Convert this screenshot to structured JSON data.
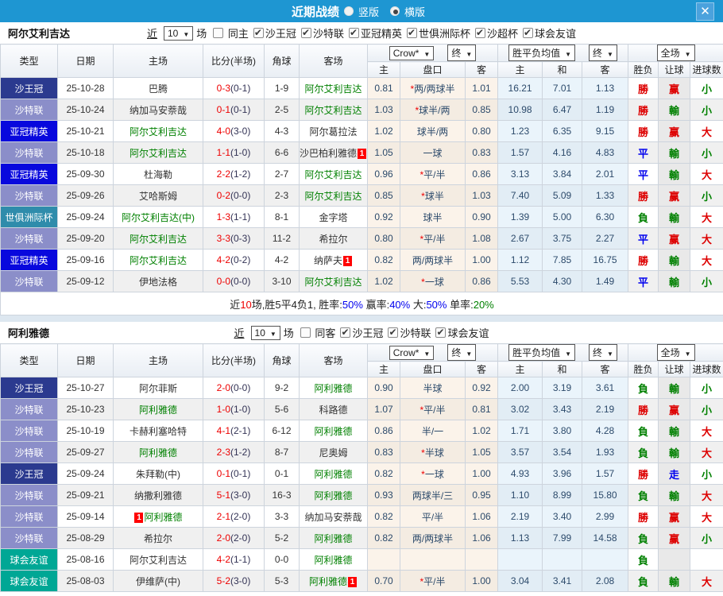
{
  "titlebar": {
    "title": "近期战绩",
    "radio_options": [
      {
        "label": "竖版",
        "selected": false
      },
      {
        "label": "横版",
        "selected": true
      }
    ],
    "close_icon": "✕"
  },
  "columns": {
    "type": "类型",
    "date": "日期",
    "home": "主场",
    "score": "比分(半场)",
    "corner": "角球",
    "away": "客场",
    "odds_home": "主",
    "handicap": "盘口",
    "odds_away": "客",
    "avg_win": "主",
    "avg_draw": "和",
    "avg_lose": "客",
    "result": "胜负",
    "handicap_result": "让球",
    "goals": "进球数"
  },
  "dropdowns": {
    "crow": "Crow*",
    "final_a": "终",
    "wdl_avg": "胜平负均值",
    "final_b": "终",
    "full": "全场"
  },
  "type_colors": {
    "沙王冠": "#2b3a8f",
    "沙特联": "#8b8ec9",
    "亚冠精英": "#0808dd",
    "世俱洲际杯": "#2f8cab",
    "球会友谊": "#00a795"
  },
  "result_colors": {
    "勝": "#dd0000",
    "赢": "#dd0000",
    "大": "#dd0000",
    "平": "#0000ee",
    "走": "#0000ee",
    "負": "#008000",
    "輸": "#008000",
    "小": "#008000"
  },
  "sections": [
    {
      "team": "阿尔艾利吉达",
      "filter": {
        "near": "近",
        "count": "10",
        "unit": "场",
        "same": {
          "label": "同主",
          "checked": false
        },
        "leagues": [
          {
            "label": "沙王冠",
            "checked": true
          },
          {
            "label": "沙特联",
            "checked": true
          },
          {
            "label": "亚冠精英",
            "checked": true
          },
          {
            "label": "世俱洲际杯",
            "checked": true
          },
          {
            "label": "沙超杯",
            "checked": true
          },
          {
            "label": "球会友谊",
            "checked": true
          }
        ]
      },
      "rows": [
        {
          "type": "沙王冠",
          "date": "25-10-28",
          "home": {
            "name": "巴腾"
          },
          "score_ft": "0-3",
          "score_ht": "(0-1)",
          "corner": "1-9",
          "away": {
            "name": "阿尔艾利吉达",
            "green": true
          },
          "crow_home": "0.81",
          "crow_hc": "*两/两球半",
          "crow_away": "1.01",
          "avg_win": "16.21",
          "avg_draw": "7.01",
          "avg_lose": "1.13",
          "res": "勝",
          "hc_res": "赢",
          "goal_res": "小"
        },
        {
          "type": "沙特联",
          "date": "25-10-24",
          "home": {
            "name": "纳加马安萘哉"
          },
          "score_ft": "0-1",
          "score_ht": "(0-1)",
          "corner": "2-5",
          "away": {
            "name": "阿尔艾利吉达",
            "green": true
          },
          "crow_home": "1.03",
          "crow_hc": "*球半/两",
          "crow_away": "0.85",
          "avg_win": "10.98",
          "avg_draw": "6.47",
          "avg_lose": "1.19",
          "res": "勝",
          "hc_res": "輸",
          "goal_res": "小"
        },
        {
          "type": "亚冠精英",
          "date": "25-10-21",
          "home": {
            "name": "阿尔艾利吉达",
            "green": true
          },
          "score_ft": "4-0",
          "score_ht": "(3-0)",
          "corner": "4-3",
          "away": {
            "name": "阿尔葛拉法"
          },
          "crow_home": "1.02",
          "crow_hc": "球半/两",
          "crow_away": "0.80",
          "avg_win": "1.23",
          "avg_draw": "6.35",
          "avg_lose": "9.15",
          "res": "勝",
          "hc_res": "赢",
          "goal_res": "大"
        },
        {
          "type": "沙特联",
          "date": "25-10-18",
          "home": {
            "name": "阿尔艾利吉达",
            "green": true
          },
          "score_ft": "1-1",
          "score_ht": "(1-0)",
          "corner": "6-6",
          "away": {
            "name": "沙巴柏利雅德",
            "rc": "post"
          },
          "crow_home": "1.05",
          "crow_hc": "一球",
          "crow_away": "0.83",
          "avg_win": "1.57",
          "avg_draw": "4.16",
          "avg_lose": "4.83",
          "res": "平",
          "hc_res": "輸",
          "goal_res": "小"
        },
        {
          "type": "亚冠精英",
          "date": "25-09-30",
          "home": {
            "name": "杜海勒"
          },
          "score_ft": "2-2",
          "score_ht": "(1-2)",
          "corner": "2-7",
          "away": {
            "name": "阿尔艾利吉达",
            "green": true
          },
          "crow_home": "0.96",
          "crow_hc": "*平/半",
          "crow_away": "0.86",
          "avg_win": "3.13",
          "avg_draw": "3.84",
          "avg_lose": "2.01",
          "res": "平",
          "hc_res": "輸",
          "goal_res": "大"
        },
        {
          "type": "沙特联",
          "date": "25-09-26",
          "home": {
            "name": "艾哈斯姆"
          },
          "score_ft": "0-2",
          "score_ht": "(0-0)",
          "corner": "2-3",
          "away": {
            "name": "阿尔艾利吉达",
            "green": true
          },
          "crow_home": "0.85",
          "crow_hc": "*球半",
          "crow_away": "1.03",
          "avg_win": "7.40",
          "avg_draw": "5.09",
          "avg_lose": "1.33",
          "res": "勝",
          "hc_res": "赢",
          "goal_res": "小"
        },
        {
          "type": "世俱洲际杯",
          "date": "25-09-24",
          "home": {
            "name": "阿尔艾利吉达(中)",
            "green": true
          },
          "score_ft": "1-3",
          "score_ht": "(1-1)",
          "corner": "8-1",
          "away": {
            "name": "金字塔"
          },
          "crow_home": "0.92",
          "crow_hc": "球半",
          "crow_away": "0.90",
          "avg_win": "1.39",
          "avg_draw": "5.00",
          "avg_lose": "6.30",
          "res": "負",
          "hc_res": "輸",
          "goal_res": "大"
        },
        {
          "type": "沙特联",
          "date": "25-09-20",
          "home": {
            "name": "阿尔艾利吉达",
            "green": true
          },
          "score_ft": "3-3",
          "score_ht": "(0-3)",
          "corner": "11-2",
          "away": {
            "name": "希拉尔"
          },
          "crow_home": "0.80",
          "crow_hc": "*平/半",
          "crow_away": "1.08",
          "avg_win": "2.67",
          "avg_draw": "3.75",
          "avg_lose": "2.27",
          "res": "平",
          "hc_res": "赢",
          "goal_res": "大"
        },
        {
          "type": "亚冠精英",
          "date": "25-09-16",
          "home": {
            "name": "阿尔艾利吉达",
            "green": true
          },
          "score_ft": "4-2",
          "score_ht": "(0-2)",
          "corner": "4-2",
          "away": {
            "name": "纳萨夫",
            "rc": "post"
          },
          "crow_home": "0.82",
          "crow_hc": "两/两球半",
          "crow_away": "1.00",
          "avg_win": "1.12",
          "avg_draw": "7.85",
          "avg_lose": "16.75",
          "res": "勝",
          "hc_res": "輸",
          "goal_res": "大"
        },
        {
          "type": "沙特联",
          "date": "25-09-12",
          "home": {
            "name": "伊地法格"
          },
          "score_ft": "0-0",
          "score_ht": "(0-0)",
          "corner": "3-10",
          "away": {
            "name": "阿尔艾利吉达",
            "green": true
          },
          "crow_home": "1.02",
          "crow_hc": "*一球",
          "crow_away": "0.86",
          "avg_win": "5.53",
          "avg_draw": "4.30",
          "avg_lose": "1.49",
          "res": "平",
          "hc_res": "輸",
          "goal_res": "小"
        }
      ],
      "summary": [
        {
          "t": "近",
          "c": "#222222"
        },
        {
          "t": "10",
          "c": "#ee0000"
        },
        {
          "t": "场,胜5平4负1, 胜率:",
          "c": "#222222"
        },
        {
          "t": "50%",
          "c": "#0000ee"
        },
        {
          "t": " 赢率:",
          "c": "#222222"
        },
        {
          "t": "40%",
          "c": "#0000ee"
        },
        {
          "t": " 大:",
          "c": "#222222"
        },
        {
          "t": "50%",
          "c": "#0000ee"
        },
        {
          "t": " 单率:",
          "c": "#222222"
        },
        {
          "t": "20%",
          "c": "#008000"
        }
      ]
    },
    {
      "team": "阿利雅德",
      "filter": {
        "near": "近",
        "count": "10",
        "unit": "场",
        "same": {
          "label": "同客",
          "checked": false
        },
        "leagues": [
          {
            "label": "沙王冠",
            "checked": true
          },
          {
            "label": "沙特联",
            "checked": true
          },
          {
            "label": "球会友谊",
            "checked": true
          }
        ]
      },
      "rows": [
        {
          "type": "沙王冠",
          "date": "25-10-27",
          "home": {
            "name": "阿尔菲斯"
          },
          "score_ft": "2-0",
          "score_ht": "(0-0)",
          "corner": "9-2",
          "away": {
            "name": "阿利雅德",
            "green": true
          },
          "crow_home": "0.90",
          "crow_hc": "半球",
          "crow_away": "0.92",
          "avg_win": "2.00",
          "avg_draw": "3.19",
          "avg_lose": "3.61",
          "res": "負",
          "hc_res": "輸",
          "goal_res": "小"
        },
        {
          "type": "沙特联",
          "date": "25-10-23",
          "home": {
            "name": "阿利雅德",
            "green": true
          },
          "score_ft": "1-0",
          "score_ht": "(1-0)",
          "corner": "5-6",
          "away": {
            "name": "科路德"
          },
          "crow_home": "1.07",
          "crow_hc": "*平/半",
          "crow_away": "0.81",
          "avg_win": "3.02",
          "avg_draw": "3.43",
          "avg_lose": "2.19",
          "res": "勝",
          "hc_res": "赢",
          "goal_res": "小"
        },
        {
          "type": "沙特联",
          "date": "25-10-19",
          "home": {
            "name": "卡赫利塞哈特"
          },
          "score_ft": "4-1",
          "score_ht": "(2-1)",
          "corner": "6-12",
          "away": {
            "name": "阿利雅德",
            "green": true
          },
          "crow_home": "0.86",
          "crow_hc": "半/一",
          "crow_away": "1.02",
          "avg_win": "1.71",
          "avg_draw": "3.80",
          "avg_lose": "4.28",
          "res": "負",
          "hc_res": "輸",
          "goal_res": "大"
        },
        {
          "type": "沙特联",
          "date": "25-09-27",
          "home": {
            "name": "阿利雅德",
            "green": true
          },
          "score_ft": "2-3",
          "score_ht": "(1-2)",
          "corner": "8-7",
          "away": {
            "name": "尼奥姆"
          },
          "crow_home": "0.83",
          "crow_hc": "*半球",
          "crow_away": "1.05",
          "avg_win": "3.57",
          "avg_draw": "3.54",
          "avg_lose": "1.93",
          "res": "負",
          "hc_res": "輸",
          "goal_res": "大"
        },
        {
          "type": "沙王冠",
          "date": "25-09-24",
          "home": {
            "name": "朱拜勒(中)"
          },
          "score_ft": "0-1",
          "score_ht": "(0-1)",
          "corner": "0-1",
          "away": {
            "name": "阿利雅德",
            "green": true
          },
          "crow_home": "0.82",
          "crow_hc": "*一球",
          "crow_away": "1.00",
          "avg_win": "4.93",
          "avg_draw": "3.96",
          "avg_lose": "1.57",
          "res": "勝",
          "hc_res": "走",
          "goal_res": "小"
        },
        {
          "type": "沙特联",
          "date": "25-09-21",
          "home": {
            "name": "纳撒利雅德"
          },
          "score_ft": "5-1",
          "score_ht": "(3-0)",
          "corner": "16-3",
          "away": {
            "name": "阿利雅德",
            "green": true
          },
          "crow_home": "0.93",
          "crow_hc": "两球半/三",
          "crow_away": "0.95",
          "avg_win": "1.10",
          "avg_draw": "8.99",
          "avg_lose": "15.80",
          "res": "負",
          "hc_res": "輸",
          "goal_res": "大"
        },
        {
          "type": "沙特联",
          "date": "25-09-14",
          "home": {
            "name": "阿利雅德",
            "green": true,
            "rc": "pre"
          },
          "score_ft": "2-1",
          "score_ht": "(2-0)",
          "corner": "3-3",
          "away": {
            "name": "纳加马安萘哉"
          },
          "crow_home": "0.82",
          "crow_hc": "平/半",
          "crow_away": "1.06",
          "avg_win": "2.19",
          "avg_draw": "3.40",
          "avg_lose": "2.99",
          "res": "勝",
          "hc_res": "赢",
          "goal_res": "大"
        },
        {
          "type": "沙特联",
          "date": "25-08-29",
          "home": {
            "name": "希拉尔"
          },
          "score_ft": "2-0",
          "score_ht": "(2-0)",
          "corner": "5-2",
          "away": {
            "name": "阿利雅德",
            "green": true
          },
          "crow_home": "0.82",
          "crow_hc": "两/两球半",
          "crow_away": "1.06",
          "avg_win": "1.13",
          "avg_draw": "7.99",
          "avg_lose": "14.58",
          "res": "負",
          "hc_res": "赢",
          "goal_res": "小"
        },
        {
          "type": "球会友谊",
          "date": "25-08-16",
          "home": {
            "name": "阿尔艾利吉达"
          },
          "score_ft": "4-2",
          "score_ht": "(1-1)",
          "corner": "0-0",
          "away": {
            "name": "阿利雅德",
            "green": true
          },
          "crow_home": "",
          "crow_hc": "",
          "crow_away": "",
          "avg_win": "",
          "avg_draw": "",
          "avg_lose": "",
          "res": "負",
          "hc_res": "",
          "goal_res": ""
        },
        {
          "type": "球会友谊",
          "date": "25-08-03",
          "home": {
            "name": "伊维萨(中)"
          },
          "score_ft": "5-2",
          "score_ht": "(3-0)",
          "corner": "5-3",
          "away": {
            "name": "阿利雅德",
            "green": true,
            "rc": "post"
          },
          "crow_home": "0.70",
          "crow_hc": "*平/半",
          "crow_away": "1.00",
          "avg_win": "3.04",
          "avg_draw": "3.41",
          "avg_lose": "2.08",
          "res": "負",
          "hc_res": "輸",
          "goal_res": "大"
        }
      ],
      "summary": null
    }
  ]
}
